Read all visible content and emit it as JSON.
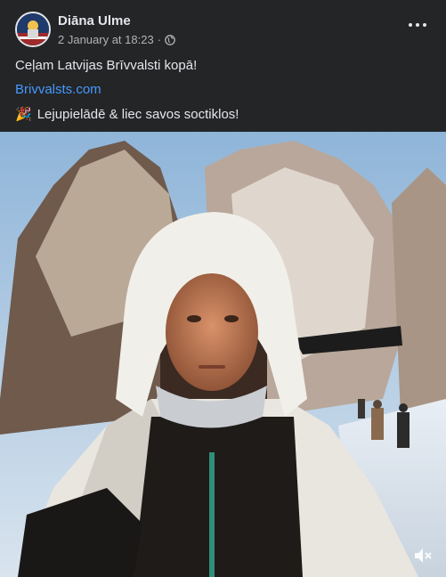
{
  "post": {
    "author": "Diāna Ulme",
    "date": "2 January at 18:23",
    "separator": "·",
    "audience_icon": "globe-icon",
    "text_line1": "Ceļam Latvijas Brīvvalsti kopā!",
    "link_text": "Brivvalsts.com",
    "text_line3": "Lejupielādē & liec savos soctiklos!",
    "emoji": "🎉"
  },
  "media": {
    "type": "video",
    "mute_icon": "speaker-muted-icon"
  },
  "colors": {
    "background": "#242526",
    "text": "#e4e6eb",
    "secondary_text": "#b0b3b8",
    "link": "#4599ff"
  }
}
